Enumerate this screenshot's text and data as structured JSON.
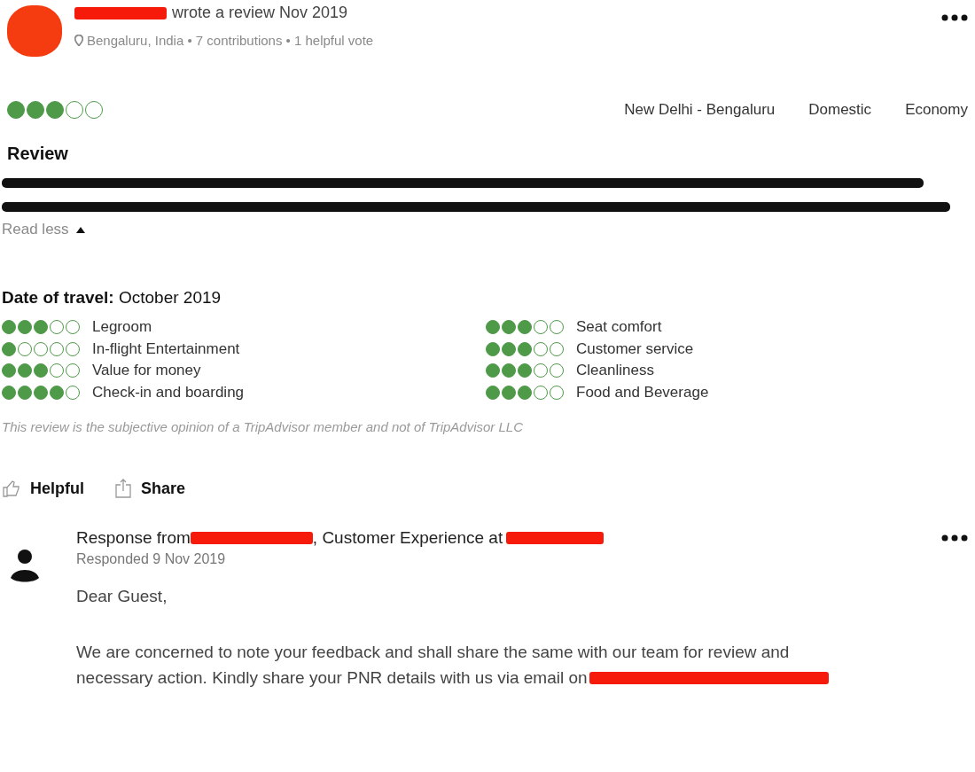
{
  "review_header": {
    "action": "wrote a review Nov 2019",
    "meta": "Bengaluru, India • 7 contributions • 1 helpful vote"
  },
  "overall": {
    "stars": 3
  },
  "tags": [
    "New Delhi - Bengaluru",
    "Domestic",
    "Economy"
  ],
  "review": {
    "heading": "Review",
    "toggle": "Read less"
  },
  "date_of_travel": "**Date of travel:** October 2019",
  "ratings": [
    {
      "label": "Legroom",
      "stars": 3
    },
    {
      "label": "In-flight Entertainment",
      "stars": 1
    },
    {
      "label": "Value for money",
      "stars": 3
    },
    {
      "label": "Check-in and boarding",
      "stars": 4
    },
    {
      "label": "Seat comfort",
      "stars": 3
    },
    {
      "label": "Customer service",
      "stars": 3
    },
    {
      "label": "Cleanliness",
      "stars": 3
    },
    {
      "label": "Food and Beverage",
      "stars": 3
    }
  ],
  "disclaimer": "This review is the subjective opinion of a TripAdvisor member and not of TripAdvisor LLC",
  "actions": [
    "Helpful",
    "Share"
  ],
  "response": {
    "from_prefix": "Response from",
    "from_middle": ", Customer Experience at",
    "date": "Responded 9 Nov 2019",
    "greeting": "Dear Guest,",
    "body_lines": [
      "We are concerned to note your feedback and shall share the same with our team for review and",
      "necessary action. Kindly share your PNR details with us via email on"
    ]
  }
}
